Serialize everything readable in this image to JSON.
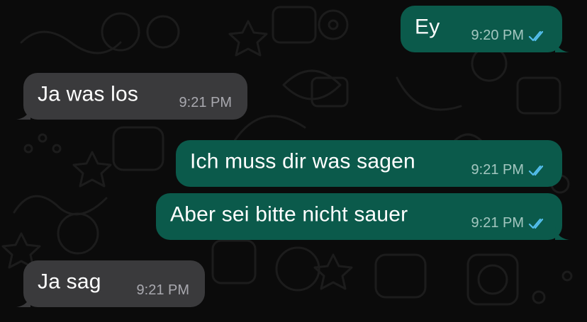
{
  "chat": {
    "messages": [
      {
        "direction": "outgoing",
        "text": "Ey",
        "time": "9:20 PM",
        "status": "read",
        "status_icon": "double-check-icon"
      },
      {
        "direction": "incoming",
        "text": "Ja was los",
        "time": "9:21 PM"
      },
      {
        "direction": "outgoing",
        "text": "Ich muss dir was sagen",
        "time": "9:21 PM",
        "status": "read",
        "status_icon": "double-check-icon"
      },
      {
        "direction": "outgoing",
        "text": "Aber sei bitte nicht sauer",
        "time": "9:21 PM",
        "status": "read",
        "status_icon": "double-check-icon"
      },
      {
        "direction": "incoming",
        "text": "Ja sag",
        "time": "9:21 PM"
      }
    ]
  },
  "colors": {
    "background": "#0b0b0b",
    "incoming_bubble": "#3a3a3c",
    "outgoing_bubble": "#0b5a4b",
    "read_tick": "#53bdeb",
    "wallpaper_doodle": "#1c1c1c"
  }
}
